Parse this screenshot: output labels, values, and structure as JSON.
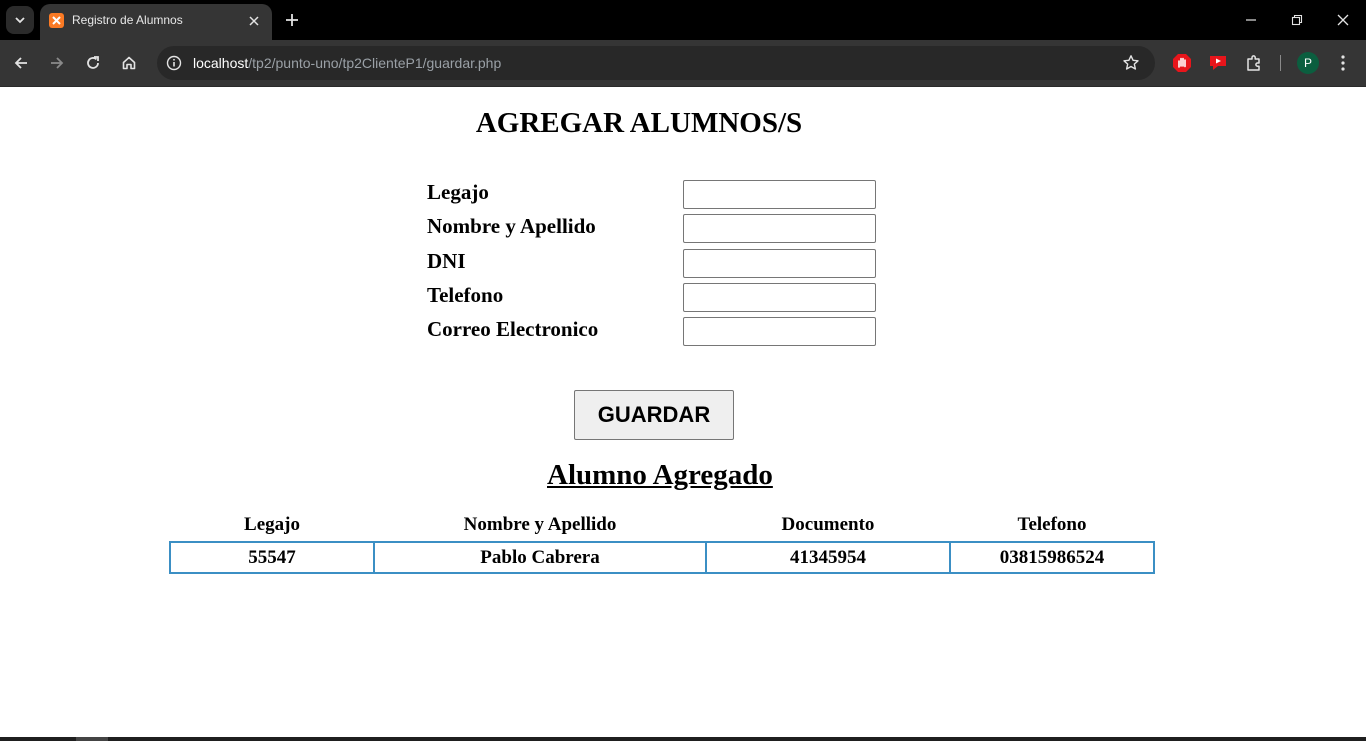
{
  "browser": {
    "tab_title": "Registro de Alumnos",
    "url_host": "localhost",
    "url_path": "/tp2/punto-uno/tp2ClienteP1/guardar.php",
    "profile_initial": "P",
    "colors": {
      "favicon": "#fb7a24",
      "avatar": "#0b5e3f",
      "ext_red": "#e8151b"
    },
    "icons": [
      "tab-search-icon",
      "close-icon",
      "plus-icon",
      "minimize-icon",
      "restore-icon",
      "back-arrow-icon",
      "forward-arrow-icon",
      "reload-icon",
      "home-icon",
      "info-icon",
      "star-icon",
      "hand-stop-icon",
      "youtube-ext-icon",
      "puzzle-icon",
      "kebab-menu-icon"
    ]
  },
  "page": {
    "title": "AGREGAR ALUMNOS/S",
    "form": {
      "fields": [
        {
          "label": "Legajo",
          "value": ""
        },
        {
          "label": "Nombre y Apellido",
          "value": ""
        },
        {
          "label": "DNI",
          "value": ""
        },
        {
          "label": "Telefono",
          "value": ""
        },
        {
          "label": "Correo Electronico",
          "value": ""
        }
      ],
      "submit_label": "GUARDAR"
    },
    "result": {
      "title": "Alumno Agregado",
      "headers": [
        "Legajo",
        "Nombre y Apellido",
        "Documento",
        "Telefono"
      ],
      "rows": [
        [
          "55547",
          "Pablo Cabrera",
          "41345954",
          "03815986524"
        ]
      ],
      "border_color": "#3b8fc4"
    }
  }
}
